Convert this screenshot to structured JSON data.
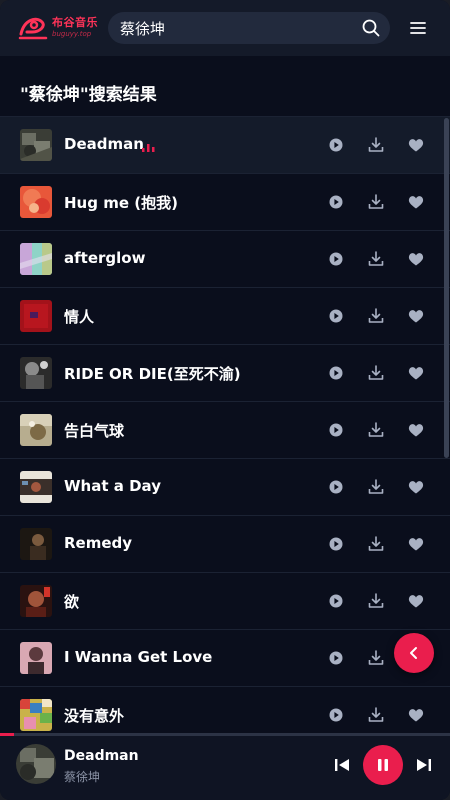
{
  "header": {
    "logo_title": "布谷音乐",
    "logo_sub": "buguyy.top",
    "search_value": "蔡徐坤",
    "search_icon": "search-icon",
    "menu_icon": "hamburger-menu-icon"
  },
  "page_title": "\"蔡徐坤\"搜索结果",
  "colors": {
    "accent": "#ea1e4d",
    "background": "#0a0e1c",
    "header_bg": "#141a29",
    "action_icon": "#a9b1c3"
  },
  "songs": [
    {
      "title": "Deadman",
      "playing": true
    },
    {
      "title": "Hug me (抱我)"
    },
    {
      "title": "afterglow"
    },
    {
      "title": "情人"
    },
    {
      "title": "RIDE OR DIE(至死不渝)"
    },
    {
      "title": "告白气球"
    },
    {
      "title": "What a Day"
    },
    {
      "title": "Remedy"
    },
    {
      "title": "欲"
    },
    {
      "title": "I Wanna Get Love"
    },
    {
      "title": "没有意外"
    }
  ],
  "row_actions": [
    "play-circle-icon",
    "download-icon",
    "heart-icon"
  ],
  "player": {
    "title": "Deadman",
    "artist": "蔡徐坤",
    "progress": 0.03,
    "controls": [
      "previous-icon",
      "pause-icon",
      "next-icon"
    ]
  }
}
